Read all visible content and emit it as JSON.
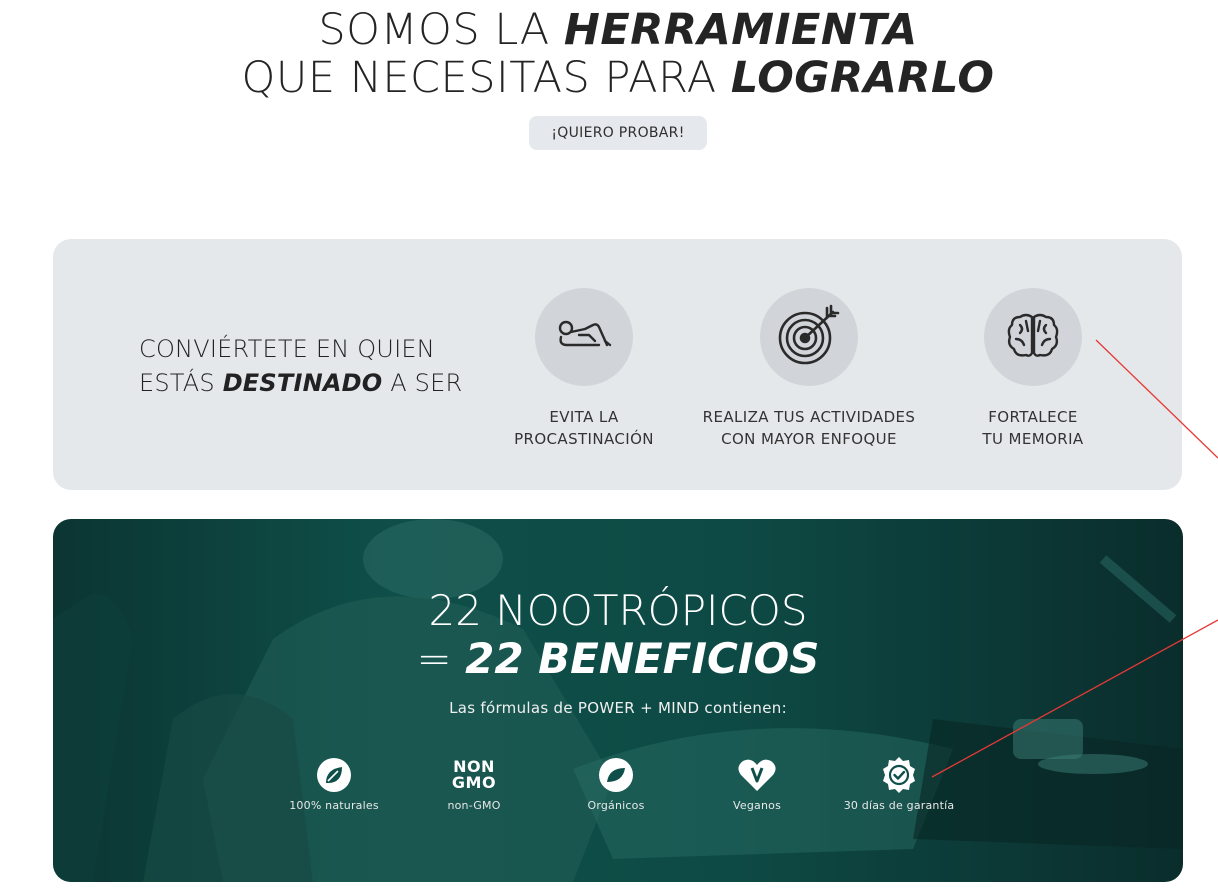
{
  "hero": {
    "line1_regular": "SOMOS LA ",
    "line1_bold": "HERRAMIENTA",
    "line2_regular": "QUE NECESITAS PARA ",
    "line2_bold": "LOGRARLO",
    "cta_label": "¡QUIERO PROBAR!"
  },
  "features": {
    "heading_line1": "CONVIÉRTETE EN QUIEN",
    "heading_line2_a": "ESTÁS ",
    "heading_line2_bold": "DESTINADO",
    "heading_line2_b": " A SER",
    "items": [
      {
        "icon": "lazy-person-icon",
        "label": "EVITA LA\nPROCASTINACIÓN"
      },
      {
        "icon": "target-icon",
        "label": "REALIZA TUS ACTIVIDADES\nCON MAYOR ENFOQUE"
      },
      {
        "icon": "brain-icon",
        "label": "FORTALECE\nTU MEMORIA"
      }
    ]
  },
  "promo": {
    "title_line1": "22 NOOTRÓPICOS",
    "title_line2_a": "= ",
    "title_line2_bold": "22 BENEFICIOS",
    "subtitle": "Las fórmulas de POWER + MIND contienen:",
    "badges": [
      {
        "icon": "leaf-icon",
        "label": "100% naturales"
      },
      {
        "icon": "non-gmo-icon",
        "label": "non-GMO",
        "icon_text_top": "NON",
        "icon_text_bottom": "GMO"
      },
      {
        "icon": "organic-leaf-icon",
        "label": "Orgánicos"
      },
      {
        "icon": "vegan-heart-icon",
        "label": "Veganos"
      },
      {
        "icon": "guarantee-seal-icon",
        "label": "30 días de garantía"
      }
    ]
  }
}
